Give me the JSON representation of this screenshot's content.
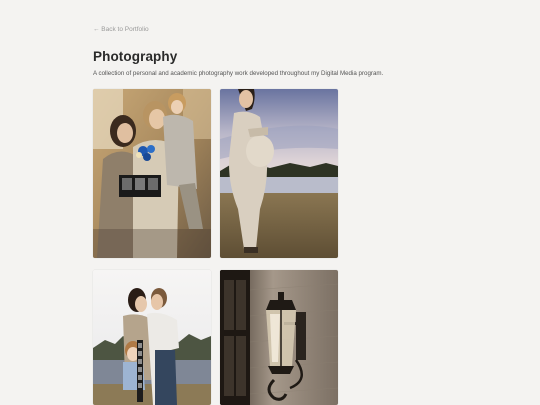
{
  "nav": {
    "back_label": "← Back to Portfolio"
  },
  "header": {
    "title": "Photography",
    "description": "A collection of personal and academic photography work developed throughout my Digital Media program."
  },
  "gallery": {
    "items": [
      {
        "subject": "family-portrait-with-sonogram"
      },
      {
        "subject": "maternity-portrait-by-lake"
      },
      {
        "subject": "couple-kissing-with-child-by-lake"
      },
      {
        "subject": "vintage-lantern-on-brick-wall"
      }
    ]
  },
  "colors": {
    "background": "#f4f3f1",
    "title": "#2a2a2a",
    "muted_text": "#9a9a9a"
  }
}
